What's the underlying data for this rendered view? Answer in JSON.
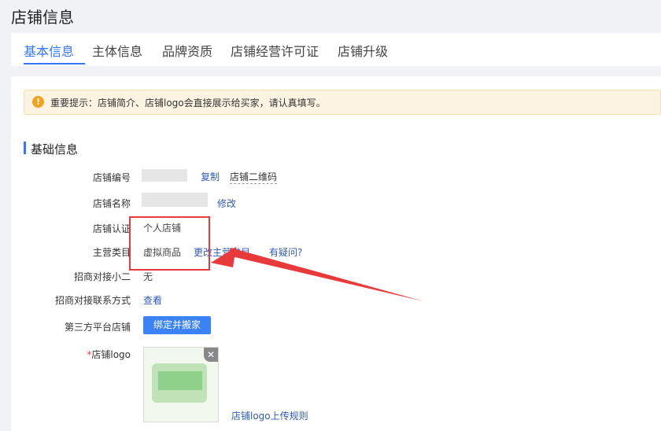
{
  "page": {
    "title": "店铺信息"
  },
  "tabs": [
    {
      "label": "基本信息",
      "active": true
    },
    {
      "label": "主体信息"
    },
    {
      "label": "品牌资质"
    },
    {
      "label": "店铺经营许可证"
    },
    {
      "label": "店铺升级"
    }
  ],
  "notice": {
    "text": "重要提示：店铺简介、店铺logo会直接展示给买家，请认真填写。"
  },
  "section": {
    "title": "基础信息"
  },
  "fields": {
    "shop_id": {
      "label": "店铺编号",
      "copy_link": "复制",
      "qr_link": "店铺二维码"
    },
    "shop_name": {
      "label": "店铺名称",
      "edit_link": "修改"
    },
    "shop_cert": {
      "label": "店铺认证",
      "value": "个人店铺"
    },
    "main_category": {
      "label": "主营类目",
      "value": "虚拟商品",
      "change_link": "更改主营类目",
      "help_link": "有疑问?"
    },
    "contact_staff": {
      "label": "招商对接小二",
      "value": "无"
    },
    "contact_method": {
      "label": "招商对接联系方式",
      "view_link": "查看"
    },
    "third_party": {
      "label": "第三方平台店铺",
      "button": "绑定并搬家"
    },
    "shop_logo": {
      "required_mark": "*",
      "label": "店铺logo",
      "rules_link": "店铺logo上传规则"
    }
  },
  "colors": {
    "accent": "#3377ff",
    "annotation": "#e83a3a"
  }
}
